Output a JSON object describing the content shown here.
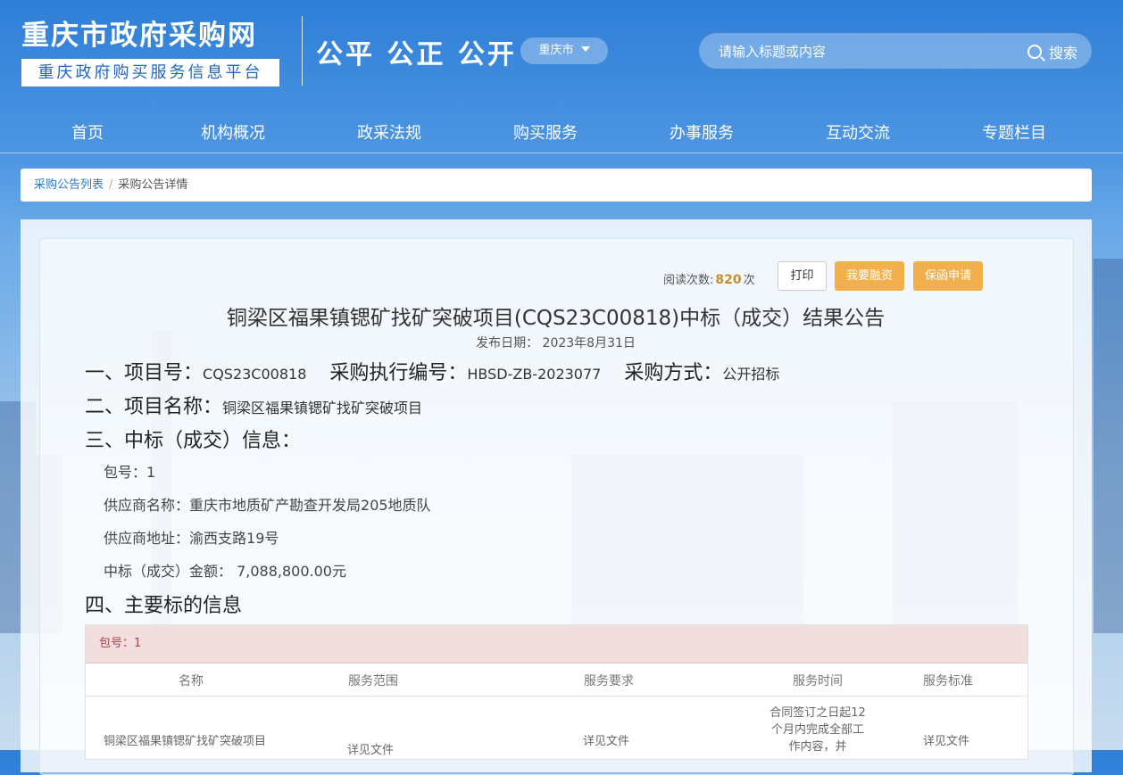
{
  "header": {
    "logo_title": "重庆市政府采购网",
    "logo_subtitle": "重庆政府购买服务信息平台",
    "slogan": "公平 公正 公开",
    "city_selector": "重庆市",
    "search_placeholder": "请输入标题或内容",
    "search_button": "搜索"
  },
  "nav": {
    "items": [
      "首页",
      "机构概况",
      "政采法规",
      "购买服务",
      "办事服务",
      "互动交流",
      "专题栏目"
    ]
  },
  "breadcrumb": {
    "link": "采购公告列表",
    "separator": "/",
    "current": "采购公告详情"
  },
  "toolbar": {
    "reads_label": "阅读次数:",
    "reads_count": "820",
    "reads_unit": "次",
    "print_label": "打印",
    "finance_label": "我要融资",
    "guarantee_label": "保函申请"
  },
  "notice": {
    "title": "铜梁区福果镇锶矿找矿突破项目(CQS23C00818)中标（成交）结果公告",
    "publish_label": "发布日期：",
    "publish_date": "2023年8月31日",
    "s1_label": "一、项目号：",
    "project_no": "CQS23C00818",
    "exec_label": "采购执行编号：",
    "exec_no": "HBSD-ZB-2023077",
    "method_label": "采购方式：",
    "method": "公开招标",
    "s2_label": "二、项目名称：",
    "project_name": "铜梁区福果镇锶矿找矿突破项目",
    "s3_label": "三、中标（成交）信息：",
    "package_label": "包号：",
    "package_no": "1",
    "supplier_label": "供应商名称：",
    "supplier_name": "重庆市地质矿产勘查开发局205地质队",
    "address_label": "供应商地址：",
    "supplier_address": "渝西支路19号",
    "amount_label": "中标（成交）金额：",
    "amount": "7,088,800.00元",
    "s4_label": "四、主要标的信息"
  },
  "table": {
    "package_header": "包号：1",
    "columns": [
      "名称",
      "服务范围",
      "服务要求",
      "服务时间",
      "服务标准"
    ],
    "rows": [
      {
        "name": "铜梁区福果镇锶矿找矿突破项目",
        "scope": "详见文件",
        "requirement": "详见文件",
        "time": "合同签订之日起12个月内完成全部工作内容，并",
        "standard": "详见文件"
      }
    ]
  }
}
